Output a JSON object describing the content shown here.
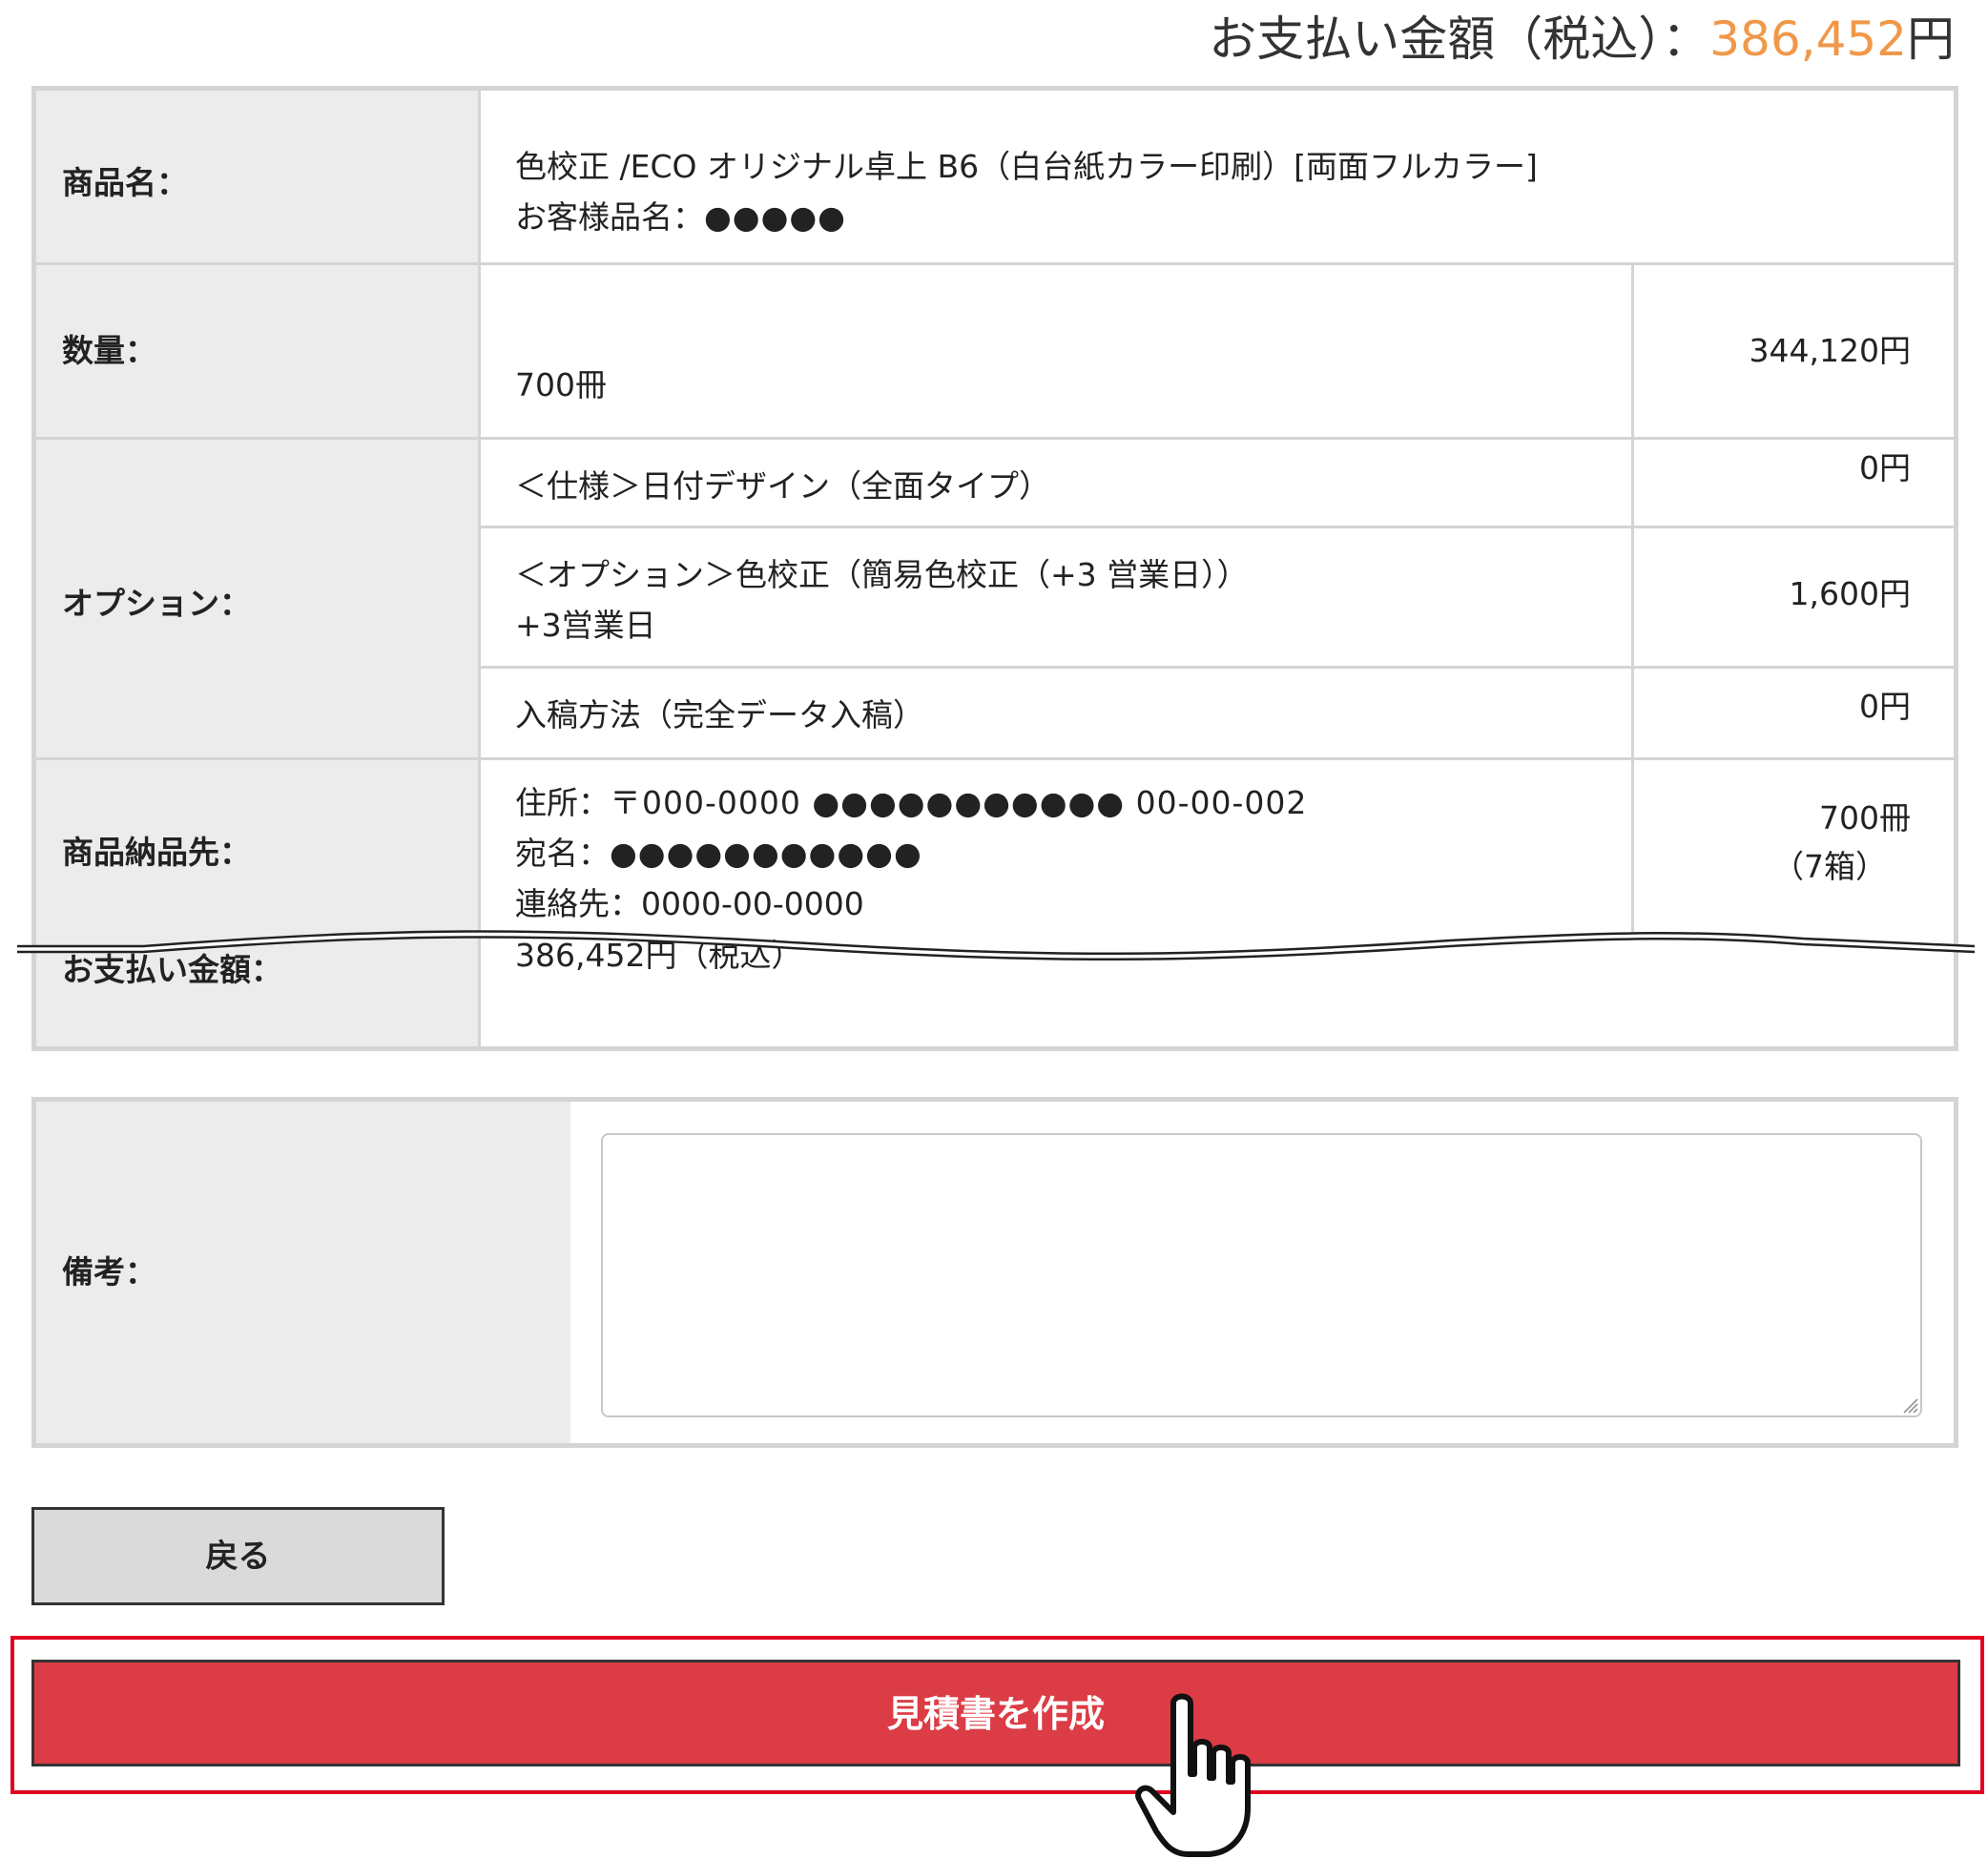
{
  "header": {
    "total_label": "お支払い金額（税込）：",
    "total_amount": "386,452",
    "total_unit": "円"
  },
  "order": {
    "product_name": {
      "label": "商品名：",
      "line1": "色校正 /ECO オリジナル卓上 B6（白台紙カラー印刷）[両面フルカラー]",
      "line2_label": "お客様品名：",
      "line2_value": "●●●●●"
    },
    "quantity": {
      "label": "数量：",
      "value": "700冊",
      "price": "344,120円"
    },
    "options": {
      "label": "オプション：",
      "items": [
        {
          "text": "＜仕様＞日付デザイン（全面タイプ）",
          "sub": "",
          "price": "0円"
        },
        {
          "text": "＜オプション＞色校正（簡易色校正（+3 営業日））",
          "sub": "+3営業日",
          "price": "1,600円"
        },
        {
          "text": "入稿方法（完全データ入稿）",
          "sub": "",
          "price": "0円"
        }
      ]
    },
    "delivery": {
      "label": "商品納品先：",
      "address_label": "住所：",
      "address_value": "〒000-0000 ●●●●●●●●●●● 00-00-002",
      "name_label": "宛名：",
      "name_value": "●●●●●●●●●●●",
      "contact_label": "連絡先：",
      "contact_value": "0000-00-0000",
      "qty": "700冊",
      "boxes": "（7箱）"
    },
    "payment": {
      "label": "お支払い金額：",
      "value": "386,452円（税込）"
    }
  },
  "remarks": {
    "label": "備考：",
    "value": ""
  },
  "buttons": {
    "back_label": "戻る",
    "create_label": "見積書を作成"
  },
  "colors": {
    "accent_orange": "#f0984a",
    "create_button": "#dc3c45",
    "highlight_frame": "#e1001f",
    "label_bg": "#ececec",
    "border": "#d4d4d4"
  },
  "icons": {
    "cursor": "hand-pointer-icon",
    "resize": "resize-grip-icon"
  }
}
